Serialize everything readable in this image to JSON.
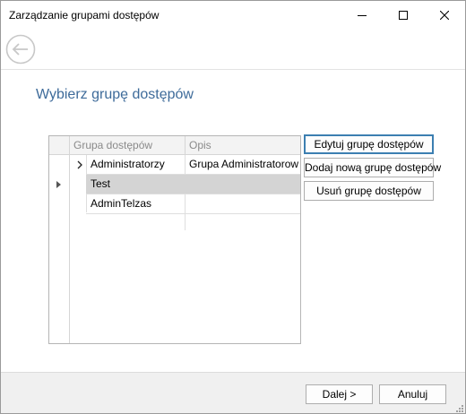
{
  "window": {
    "title": "Zarządzanie grupami dostępów"
  },
  "page": {
    "heading": "Wybierz grupę dostępów"
  },
  "grid": {
    "columns": [
      "Grupa dostępów",
      "Opis"
    ],
    "rows": [
      {
        "name": "Administratorzy",
        "description": "Grupa Administratorow",
        "expanded_marker": ">"
      },
      {
        "name": "Test",
        "description": "",
        "selected": true
      },
      {
        "name": "AdminTelzas",
        "description": ""
      }
    ]
  },
  "actions": {
    "edit_label": "Edytuj grupę dostępów",
    "add_label": "Dodaj nową grupę dostępów",
    "delete_label": "Usuń grupę dostępów"
  },
  "footer": {
    "next_label": "Dalej >",
    "cancel_label": "Anuluj"
  },
  "colors": {
    "heading": "#3e6b9a",
    "selected_row": "#d4d4d4",
    "footer_bg": "#f0f0f0"
  }
}
